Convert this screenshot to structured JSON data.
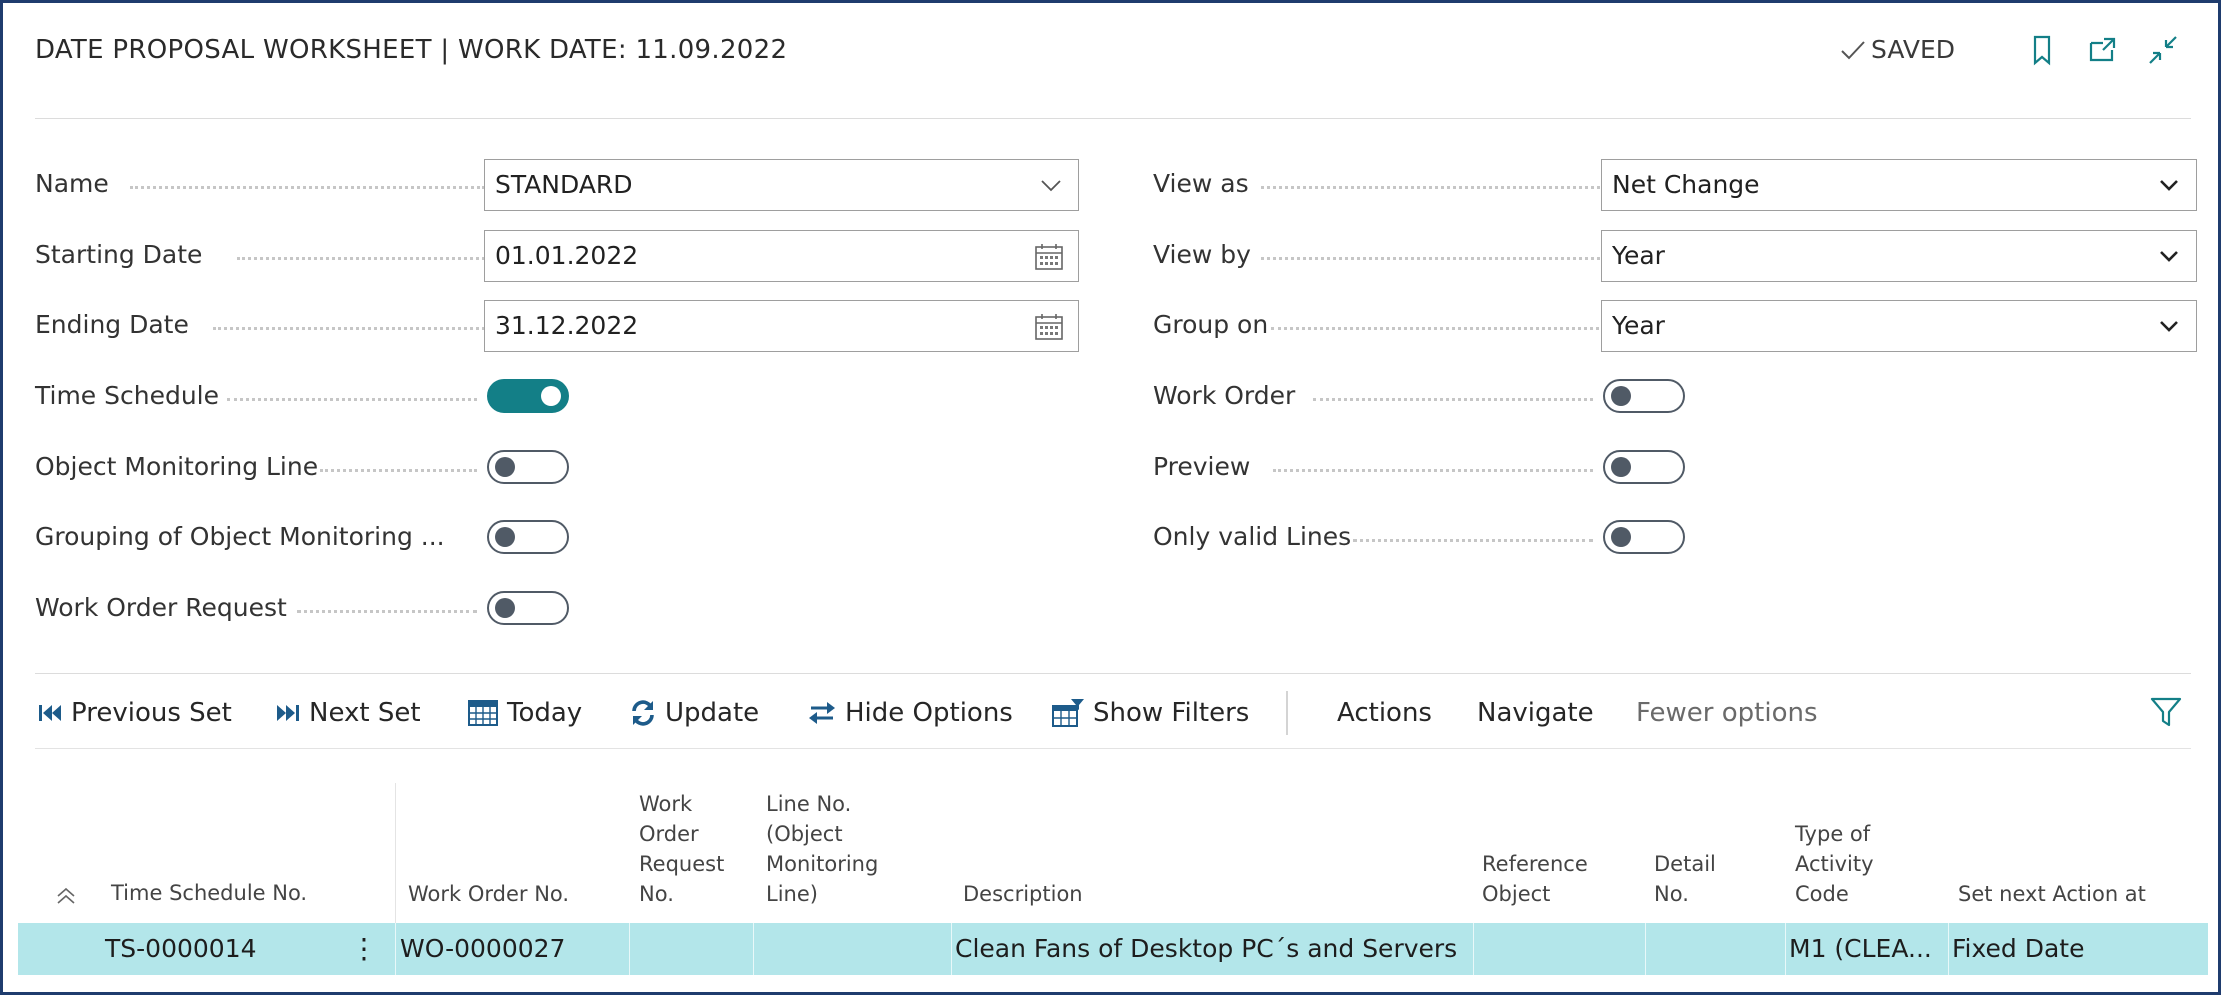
{
  "header": {
    "title": "DATE PROPOSAL WORKSHEET | WORK DATE: 11.09.2022",
    "status": "SAVED",
    "icons": [
      "bookmark-icon",
      "open-new-window-icon",
      "collapse-icon"
    ]
  },
  "form": {
    "left": {
      "name": {
        "label": "Name",
        "value": "STANDARD"
      },
      "starting_date": {
        "label": "Starting Date",
        "value": "01.01.2022"
      },
      "ending_date": {
        "label": "Ending Date",
        "value": "31.12.2022"
      },
      "time_schedule": {
        "label": "Time Schedule",
        "on": true
      },
      "object_monitoring_line": {
        "label": "Object Monitoring Line",
        "on": false
      },
      "grouping_object_monitoring": {
        "label": "Grouping of Object Monitoring ...",
        "on": false
      },
      "work_order_request": {
        "label": "Work Order Request",
        "on": false
      }
    },
    "right": {
      "view_as": {
        "label": "View as",
        "value": "Net Change"
      },
      "view_by": {
        "label": "View by",
        "value": "Year"
      },
      "group_on": {
        "label": "Group on",
        "value": "Year"
      },
      "work_order": {
        "label": "Work Order",
        "on": false
      },
      "preview": {
        "label": "Preview",
        "on": false
      },
      "only_valid_lines": {
        "label": "Only valid Lines",
        "on": false
      }
    }
  },
  "actions": {
    "previous_set": "Previous Set",
    "next_set": "Next Set",
    "today": "Today",
    "update": "Update",
    "hide_options": "Hide Options",
    "show_filters": "Show Filters",
    "actions_menu": "Actions",
    "navigate": "Navigate",
    "fewer_options": "Fewer options"
  },
  "grid": {
    "columns": {
      "time_schedule_no": "Time Schedule No.",
      "work_order_no": "Work Order No.",
      "work_order_request_no": [
        "Work",
        "Order",
        "Request",
        "No."
      ],
      "line_no": [
        "Line No.",
        "(Object",
        "Monitoring",
        "Line)"
      ],
      "description": "Description",
      "reference_object": [
        "Reference",
        "Object"
      ],
      "detail_no": [
        "Detail",
        "No."
      ],
      "type_of_activity_code": [
        "Type of",
        "Activity",
        "Code"
      ],
      "set_next_action_at": "Set next Action at"
    },
    "rows": [
      {
        "time_schedule_no": "TS-0000014",
        "work_order_no": "WO-0000027",
        "work_order_request_no": "",
        "line_no": "",
        "description": "Clean Fans of Desktop PC´s and Servers",
        "reference_object": "",
        "detail_no": "",
        "type_of_activity_code": "M1 (CLEA...",
        "set_next_action_at": "Fixed Date"
      }
    ]
  }
}
